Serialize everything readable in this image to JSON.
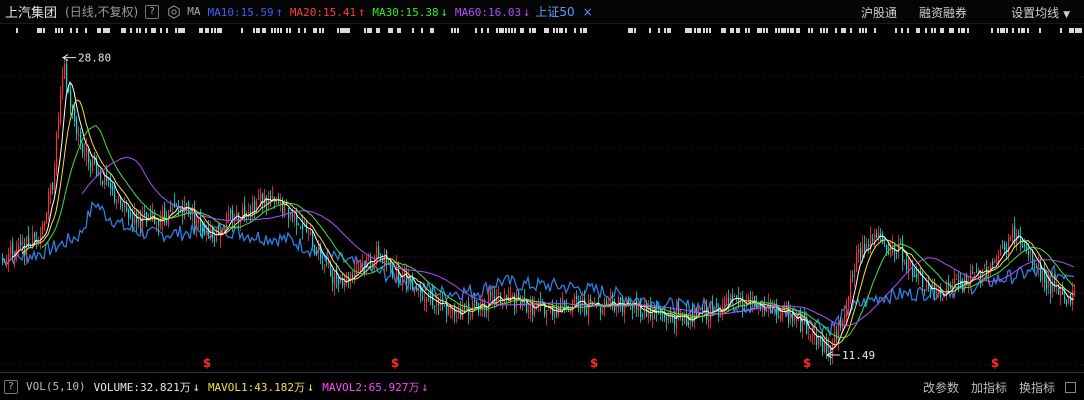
{
  "header": {
    "stock_name": "上汽集团",
    "mode": "(日线,不复权)",
    "help": "?",
    "ma_label": "MA",
    "ma": [
      {
        "text": "MA10:15.59",
        "color": "#3f5bff",
        "arrow": "↑"
      },
      {
        "text": "MA20:15.41",
        "color": "#ff3b3b",
        "arrow": "↑"
      },
      {
        "text": "MA30:15.38",
        "color": "#38e838",
        "arrow": "↓"
      },
      {
        "text": "MA60:16.03",
        "color": "#b44cff",
        "arrow": "↓"
      }
    ],
    "index_label": "上证50",
    "close_glyph": "×",
    "links": {
      "hgt": "沪股通",
      "margin": "融资融券",
      "setma": "设置均线"
    }
  },
  "price_annotations": {
    "high": "28.80",
    "low": "11.49"
  },
  "dividend_marker": "$",
  "bottom": {
    "help": "?",
    "indicator_name": "VOL(5,10)",
    "items": [
      {
        "text": "VOLUME:32.821万",
        "color": "#e8e8e8",
        "arrow": "↓"
      },
      {
        "text": "MAVOL1:43.182万",
        "color": "#f0e040",
        "arrow": "↓"
      },
      {
        "text": "MAVOL2:65.927万",
        "color": "#ff48ff",
        "arrow": "↓"
      }
    ],
    "links": {
      "change_param": "改参数",
      "add_indicator": "加指标",
      "switch_indicator": "换指标"
    }
  },
  "colors": {
    "up": "#ff3232",
    "down": "#00e0e0",
    "grid": "#6e1010",
    "index_line": "#2f7fe0",
    "ma10": "#ffffff",
    "ma20": "#f0e040",
    "ma30": "#40e040",
    "ma60": "#b44cff"
  },
  "chart_data": {
    "type": "candlestick",
    "ylim": [
      10.5,
      30.0
    ],
    "high_value": 28.8,
    "low_value": 11.49,
    "keypoints": [
      [
        0,
        17.2
      ],
      [
        20,
        17.6
      ],
      [
        40,
        18.6
      ],
      [
        52,
        21.5
      ],
      [
        60,
        26.5
      ],
      [
        64,
        28.0
      ],
      [
        72,
        25.5
      ],
      [
        82,
        23.5
      ],
      [
        95,
        22.5
      ],
      [
        110,
        21.0
      ],
      [
        125,
        19.8
      ],
      [
        145,
        19.2
      ],
      [
        165,
        19.6
      ],
      [
        185,
        20.2
      ],
      [
        200,
        19.0
      ],
      [
        215,
        18.6
      ],
      [
        230,
        19.4
      ],
      [
        245,
        20.0
      ],
      [
        262,
        20.6
      ],
      [
        280,
        20.1
      ],
      [
        298,
        19.4
      ],
      [
        315,
        17.8
      ],
      [
        330,
        16.2
      ],
      [
        345,
        15.9
      ],
      [
        360,
        16.8
      ],
      [
        378,
        17.4
      ],
      [
        392,
        16.4
      ],
      [
        410,
        15.9
      ],
      [
        430,
        14.8
      ],
      [
        450,
        13.9
      ],
      [
        470,
        14.3
      ],
      [
        490,
        14.6
      ],
      [
        510,
        14.7
      ],
      [
        530,
        14.3
      ],
      [
        550,
        14.1
      ],
      [
        570,
        14.5
      ],
      [
        590,
        14.3
      ],
      [
        610,
        14.6
      ],
      [
        630,
        14.4
      ],
      [
        650,
        14.0
      ],
      [
        670,
        13.7
      ],
      [
        690,
        13.7
      ],
      [
        710,
        14.0
      ],
      [
        730,
        14.5
      ],
      [
        750,
        14.4
      ],
      [
        770,
        14.1
      ],
      [
        790,
        13.8
      ],
      [
        806,
        13.1
      ],
      [
        820,
        12.2
      ],
      [
        828,
        11.7
      ],
      [
        836,
        12.6
      ],
      [
        846,
        14.6
      ],
      [
        856,
        17.0
      ],
      [
        866,
        18.2
      ],
      [
        876,
        18.5
      ],
      [
        886,
        17.3
      ],
      [
        898,
        17.7
      ],
      [
        910,
        16.6
      ],
      [
        922,
        15.6
      ],
      [
        934,
        15.0
      ],
      [
        950,
        15.5
      ],
      [
        968,
        15.8
      ],
      [
        985,
        16.6
      ],
      [
        1000,
        17.3
      ],
      [
        1012,
        18.5
      ],
      [
        1025,
        17.6
      ],
      [
        1040,
        16.2
      ],
      [
        1055,
        15.1
      ],
      [
        1066,
        14.8
      ],
      [
        1075,
        15.0
      ]
    ],
    "index_keypoints": [
      [
        0,
        17.0
      ],
      [
        40,
        17.4
      ],
      [
        60,
        17.9
      ],
      [
        80,
        18.5
      ],
      [
        95,
        20.4
      ],
      [
        105,
        19.7
      ],
      [
        125,
        18.9
      ],
      [
        150,
        18.5
      ],
      [
        185,
        18.6
      ],
      [
        225,
        18.8
      ],
      [
        255,
        18.4
      ],
      [
        290,
        18.2
      ],
      [
        320,
        17.4
      ],
      [
        360,
        16.7
      ],
      [
        400,
        15.9
      ],
      [
        440,
        15.1
      ],
      [
        480,
        15.2
      ],
      [
        500,
        15.8
      ],
      [
        520,
        15.6
      ],
      [
        560,
        15.5
      ],
      [
        600,
        15.2
      ],
      [
        640,
        14.7
      ],
      [
        680,
        14.3
      ],
      [
        720,
        14.4
      ],
      [
        760,
        14.3
      ],
      [
        800,
        13.9
      ],
      [
        820,
        13.3
      ],
      [
        830,
        13.0
      ],
      [
        850,
        14.2
      ],
      [
        880,
        14.9
      ],
      [
        920,
        15.1
      ],
      [
        960,
        15.3
      ],
      [
        1000,
        15.9
      ],
      [
        1030,
        16.3
      ],
      [
        1060,
        16.2
      ],
      [
        1075,
        16.4
      ]
    ],
    "dividend_x": [
      207,
      395,
      594,
      807,
      995
    ]
  }
}
